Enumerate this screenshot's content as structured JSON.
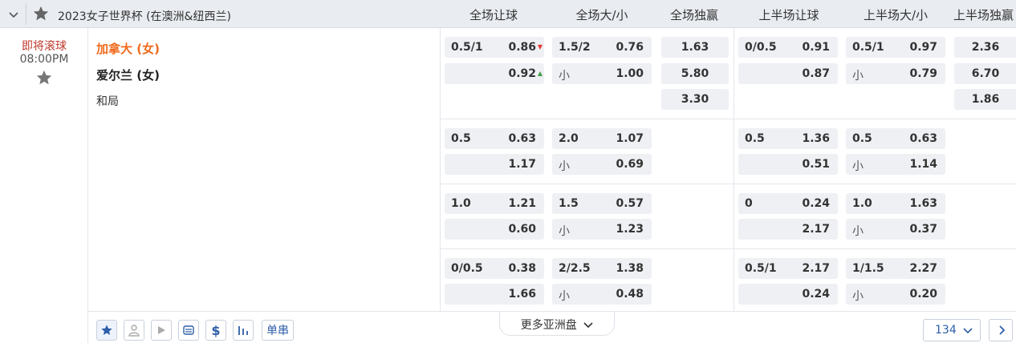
{
  "header": {
    "league": "2023女子世界杯 (在澳洲&纽西兰)",
    "columns": [
      "全场让球",
      "全场大/小",
      "全场独赢",
      "上半场让球",
      "上半场大/小",
      "上半场独赢"
    ]
  },
  "match": {
    "status": "即将滚球",
    "time": "08:00PM",
    "home": "加拿大 (女)",
    "away": "爱尔兰 (女)",
    "draw": "和局"
  },
  "odds": {
    "row1": {
      "ft_hdp": {
        "line": "0.5/1",
        "home": "0.86",
        "away": "0.92"
      },
      "ft_ou": {
        "line": "1.5/2",
        "over": "0.76",
        "under_label": "小",
        "under": "1.00"
      },
      "ft_1x2": {
        "home": "1.63",
        "away": "5.80",
        "draw": "3.30"
      },
      "ht_hdp": {
        "line": "0/0.5",
        "home": "0.91",
        "away": "0.87"
      },
      "ht_ou": {
        "line": "0.5/1",
        "over": "0.97",
        "under_label": "小",
        "under": "0.79"
      },
      "ht_1x2": {
        "home": "2.36",
        "away": "6.70",
        "draw": "1.86"
      }
    },
    "row2": {
      "ft_hdp": {
        "line": "0.5",
        "home": "0.63",
        "away": "1.17"
      },
      "ft_ou": {
        "line": "2.0",
        "over": "1.07",
        "under_label": "小",
        "under": "0.69"
      },
      "ht_hdp": {
        "line": "0.5",
        "home": "1.36",
        "away": "0.51"
      },
      "ht_ou": {
        "line": "0.5",
        "over": "0.63",
        "under_label": "小",
        "under": "1.14"
      }
    },
    "row3": {
      "ft_hdp": {
        "line": "1.0",
        "home": "1.21",
        "away": "0.60"
      },
      "ft_ou": {
        "line": "1.5",
        "over": "0.57",
        "under_label": "小",
        "under": "1.23"
      },
      "ht_hdp": {
        "line": "0",
        "home": "0.24",
        "away": "2.17"
      },
      "ht_ou": {
        "line": "1.0",
        "over": "1.63",
        "under_label": "小",
        "under": "0.37"
      }
    },
    "row4": {
      "ft_hdp": {
        "line": "0/0.5",
        "home": "0.38",
        "away": "1.66"
      },
      "ft_ou": {
        "line": "2/2.5",
        "over": "1.38",
        "under_label": "小",
        "under": "0.48"
      },
      "ht_hdp": {
        "line": "0.5/1",
        "home": "2.17",
        "away": "0.24"
      },
      "ht_ou": {
        "line": "1/1.5",
        "over": "2.27",
        "under_label": "小",
        "under": "0.20"
      }
    }
  },
  "footer": {
    "single_label": "单串",
    "more_label": "更多亚洲盘",
    "count": "134"
  },
  "colors": {
    "home_team": "#f06a1d",
    "status": "#c0392b",
    "accent": "#2d5ea8",
    "odds_down": "#e53935",
    "odds_up": "#43a047"
  },
  "icons": [
    "chevron-down-icon",
    "star-icon",
    "favorite-star-icon",
    "pin-icon",
    "user-icon",
    "play-icon",
    "ticket-icon",
    "dollar-icon",
    "stats-icon",
    "chevron-right-icon"
  ]
}
